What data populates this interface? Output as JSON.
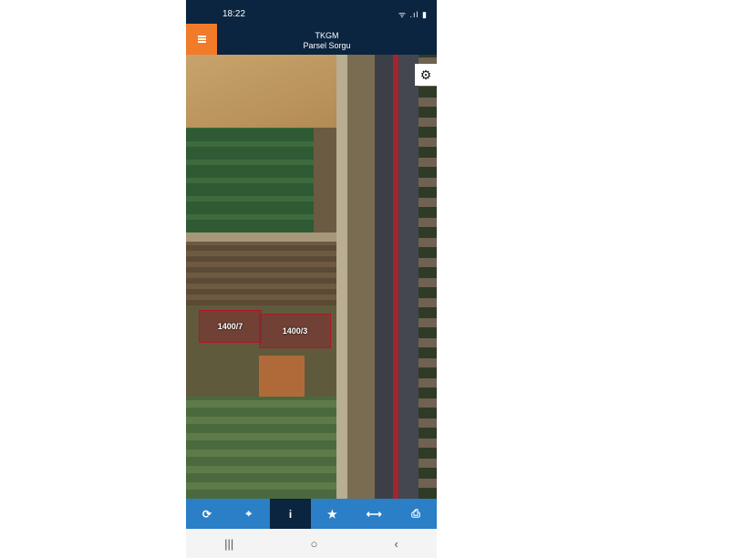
{
  "status": {
    "time": "18:22",
    "icons": "ᯤ .ıl ▮"
  },
  "header": {
    "title": "TKGM",
    "subtitle": "Parsel Sorgu"
  },
  "parcels": [
    {
      "label": "1400/7"
    },
    {
      "label": "1400/3"
    }
  ],
  "icons": {
    "menu": "menu-icon",
    "settings": "gear-icon",
    "refresh": "refresh-icon",
    "locate": "crosshair-icon",
    "info": "info-icon",
    "favorite": "star-icon",
    "measure": "measure-icon",
    "print": "print-icon"
  },
  "toolbar": {
    "refresh": "⟳",
    "locate": "⌖",
    "info": "i",
    "favorite": "★",
    "measure": "⟷",
    "print": "⎙"
  },
  "navbar": {
    "recent": "|||",
    "home": "○",
    "back": "‹"
  },
  "colors": {
    "header": "#0b2440",
    "accent": "#f27b2a",
    "toolbar": "#2a7fc6",
    "parcel_border": "#b0162a"
  }
}
